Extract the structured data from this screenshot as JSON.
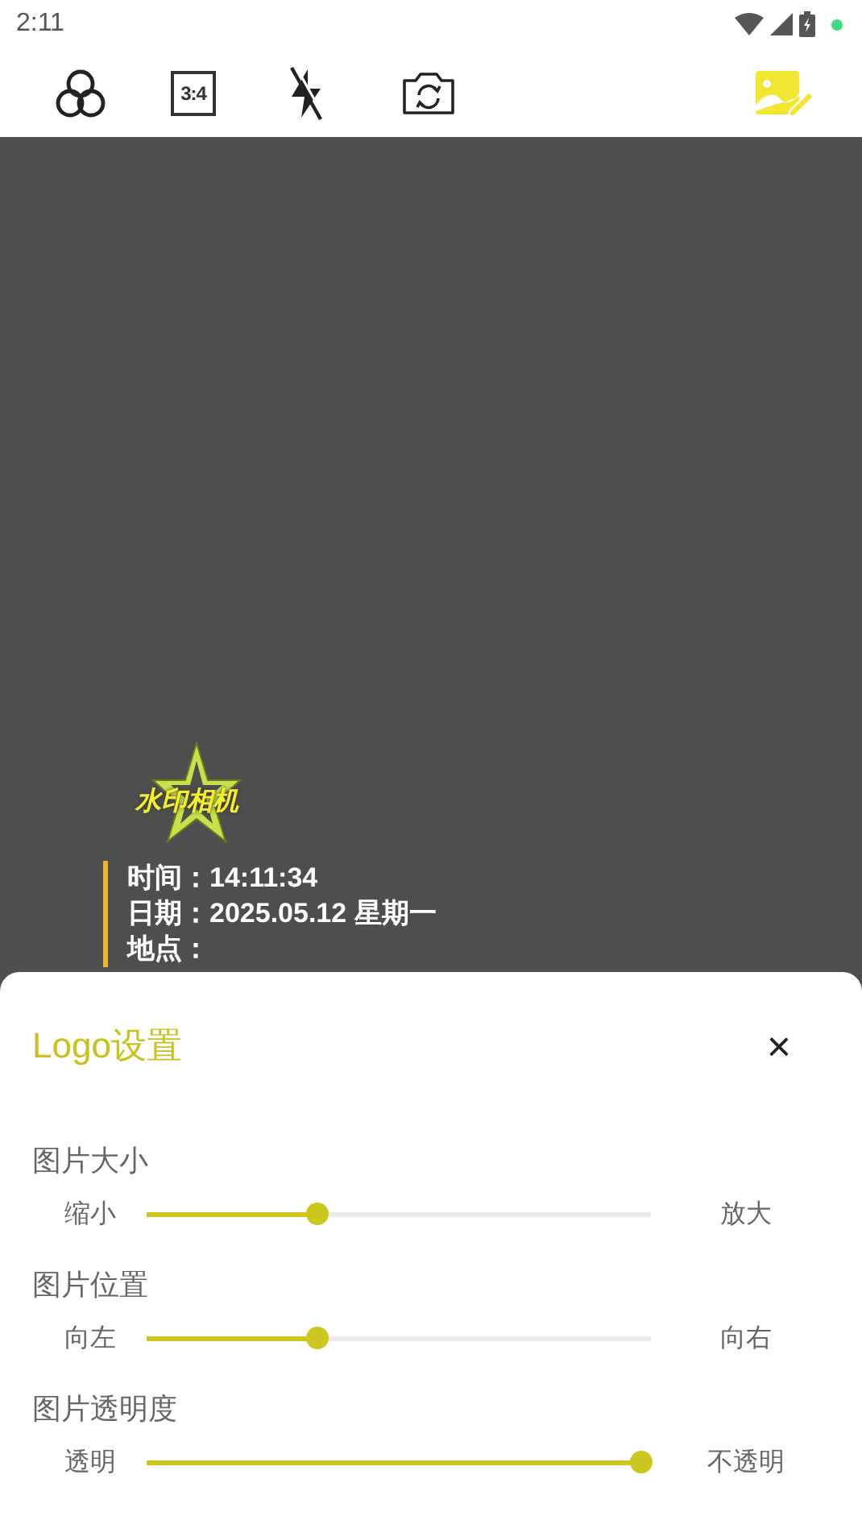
{
  "status_bar": {
    "time": "2:11"
  },
  "toolbar": [
    {
      "kind": "filter",
      "selected": false
    },
    {
      "kind": "ratio",
      "label": "3:4",
      "selected": false
    },
    {
      "kind": "flash_off",
      "selected": false
    },
    {
      "kind": "switch_camera",
      "selected": false
    },
    {
      "kind": "logo_edit",
      "selected": true
    }
  ],
  "watermark": {
    "logo_text": "水印相机",
    "lines": [
      {
        "label": "时间：",
        "value": "14:11:34"
      },
      {
        "label": "日期：",
        "value": "2025.05.12 星期一"
      },
      {
        "label": "地点："
      }
    ]
  },
  "sheet": {
    "title": "Logo设置",
    "close": "×",
    "settings": [
      {
        "label": "图片大小",
        "min_label": "缩小",
        "max_label": "放大",
        "level": 0.34
      },
      {
        "label": "图片位置",
        "min_label": "向左",
        "max_label": "向右",
        "level": 0.34
      },
      {
        "label": "图片透明度",
        "min_label": "透明",
        "max_label": "不透明",
        "level": 0.98
      }
    ]
  }
}
